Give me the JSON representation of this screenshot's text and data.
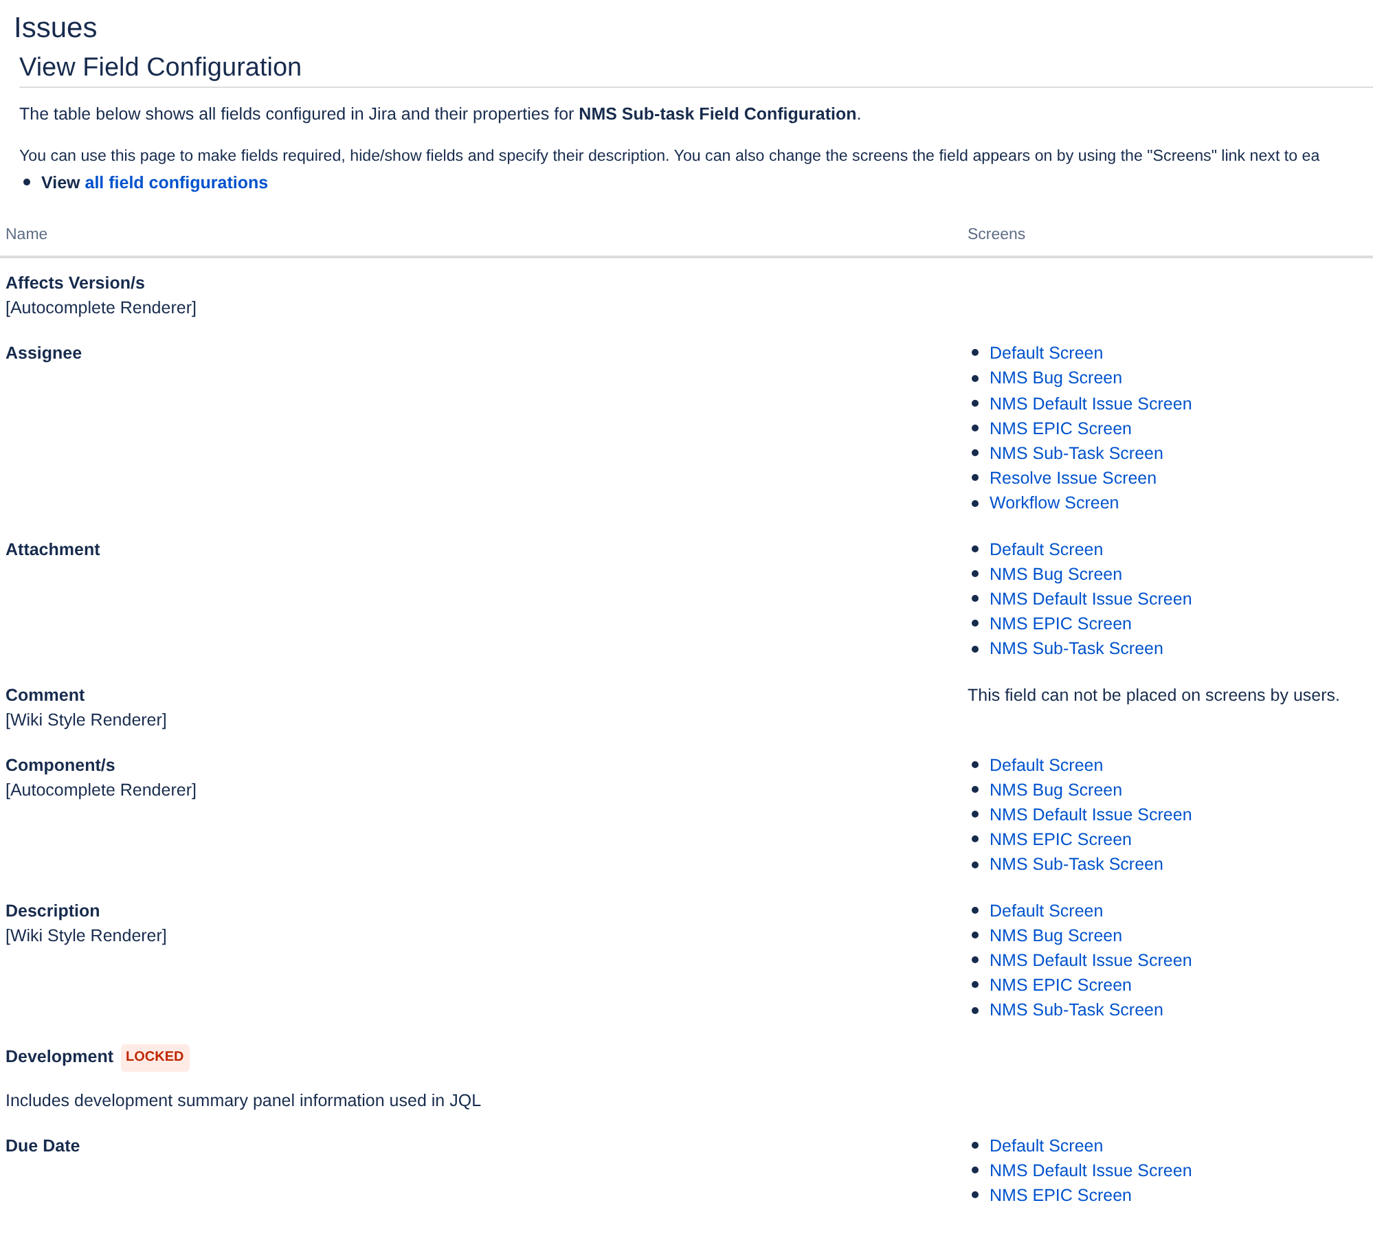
{
  "page_title": "Issues",
  "heading": "View Field Configuration",
  "intro": "The table below shows all fields configured in Jira and their properties for **NMS Sub-task Field Configuration**.",
  "help": "You can use this page to make fields required, hide/show fields and specify their description. You can also change the screens the field appears on by using the \"Screens\" link next to ea",
  "view_link": {
    "prefix": "View",
    "link": "all field configurations"
  },
  "table": {
    "columns": [
      "Name",
      "Screens"
    ],
    "rows": [
      {
        "name": "Affects Version/s",
        "renderer": "[Autocomplete Renderer]",
        "screens": []
      },
      {
        "name": "Assignee",
        "screens": [
          "Default Screen",
          "NMS Bug Screen",
          "NMS Default Issue Screen",
          "NMS EPIC Screen",
          "NMS Sub-Task Screen",
          "Resolve Issue Screen",
          "Workflow Screen"
        ]
      },
      {
        "name": "Attachment",
        "screens": [
          "Default Screen",
          "NMS Bug Screen",
          "NMS Default Issue Screen",
          "NMS EPIC Screen",
          "NMS Sub-Task Screen"
        ]
      },
      {
        "name": "Comment",
        "renderer": "[Wiki Style Renderer]",
        "note": "This field can not be placed on screens by users.",
        "screens": []
      },
      {
        "name": "Component/s",
        "renderer": "[Autocomplete Renderer]",
        "screens": [
          "Default Screen",
          "NMS Bug Screen",
          "NMS Default Issue Screen",
          "NMS EPIC Screen",
          "NMS Sub-Task Screen"
        ]
      },
      {
        "name": "Description",
        "renderer": "[Wiki Style Renderer]",
        "screens": [
          "Default Screen",
          "NMS Bug Screen",
          "NMS Default Issue Screen",
          "NMS EPIC Screen",
          "NMS Sub-Task Screen"
        ]
      },
      {
        "name": "Development",
        "badge": "LOCKED",
        "description": "Includes development summary panel information used in JQL",
        "screens": []
      },
      {
        "name": "Due Date",
        "screens": [
          "Default Screen",
          "NMS Default Issue Screen",
          "NMS EPIC Screen"
        ]
      }
    ]
  }
}
